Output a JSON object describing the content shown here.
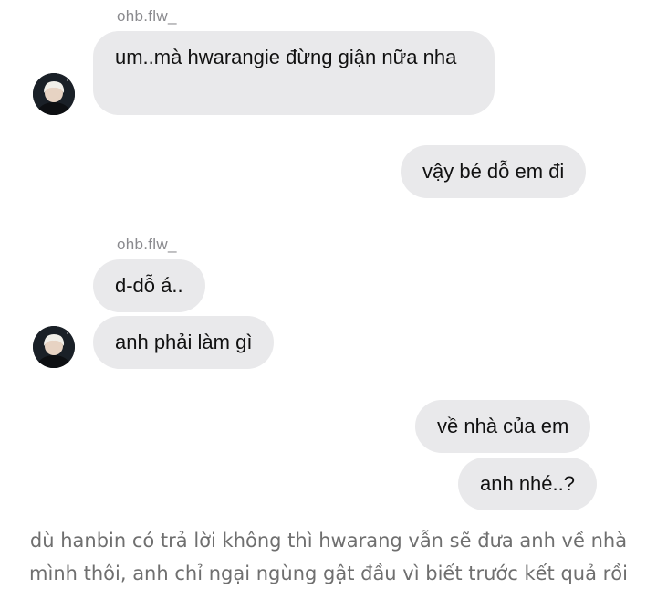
{
  "chat": {
    "messages": [
      {
        "sender": "ohb.flw_",
        "text": "um..mà hwarangie đừng giận nữa nha"
      },
      {
        "text": "vậy bé dỗ em đi"
      },
      {
        "sender": "ohb.flw_",
        "text": "d-dỗ á.."
      },
      {
        "text": "anh phải làm gì"
      },
      {
        "text": "về nhà của em"
      },
      {
        "text": "anh nhé..?"
      }
    ],
    "colors": {
      "bubble": "#e9e9eb",
      "sender_label": "#8a8a8e",
      "caption": "#6f6f6f"
    }
  },
  "caption": {
    "line1": "dù hanbin có trả lời không thì hwarang vẫn sẽ đưa anh về nhà",
    "line2": "mình thôi, anh chỉ ngại ngùng gật đầu vì biết trước kết quả rồi"
  }
}
